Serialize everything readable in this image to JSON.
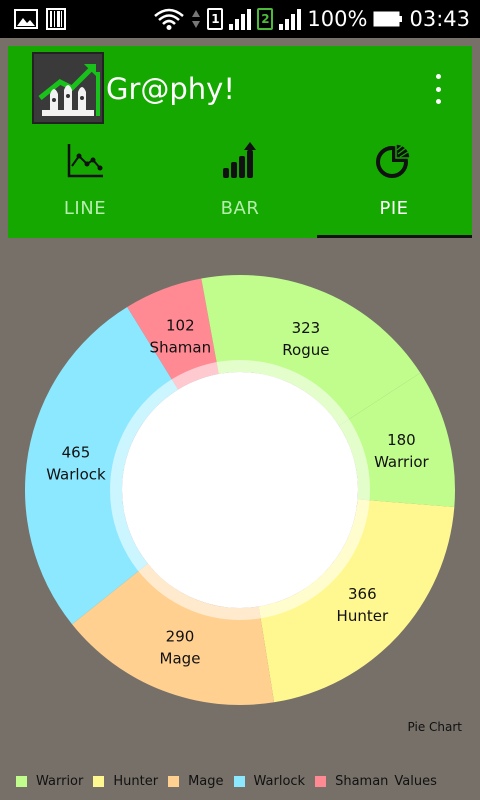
{
  "status_bar": {
    "sim1": "1",
    "sim2": "2",
    "battery": "100%",
    "time": "03:43"
  },
  "app": {
    "title": "Gr@phy!"
  },
  "tabs": [
    {
      "label": "LINE",
      "icon": "line-chart-icon",
      "active": false
    },
    {
      "label": "BAR",
      "icon": "bar-chart-icon",
      "active": false
    },
    {
      "label": "PIE",
      "icon": "pie-chart-icon",
      "active": true
    }
  ],
  "colors": {
    "app_bar": "#14a800",
    "background": "#767068"
  },
  "chart_data": {
    "type": "pie",
    "description": "Pie Chart",
    "legend_title": "Values",
    "legend_position": "bottom-left",
    "hole": true,
    "categories": [
      "Warrior",
      "Hunter",
      "Mage",
      "Warlock",
      "Shaman",
      "Rogue"
    ],
    "values": [
      180,
      366,
      290,
      465,
      102,
      323
    ],
    "colors": [
      "#c0fd8c",
      "#fff890",
      "#ffd090",
      "#8ce8ff",
      "#ff8a94",
      "#c0fd8c"
    ],
    "legend": [
      {
        "label": "Warrior",
        "color": "#c0fd8c"
      },
      {
        "label": "Hunter",
        "color": "#fff890"
      },
      {
        "label": "Mage",
        "color": "#ffd090"
      },
      {
        "label": "Warlock",
        "color": "#8ce8ff"
      },
      {
        "label": "Shaman",
        "color": "#ff8a94"
      }
    ]
  }
}
